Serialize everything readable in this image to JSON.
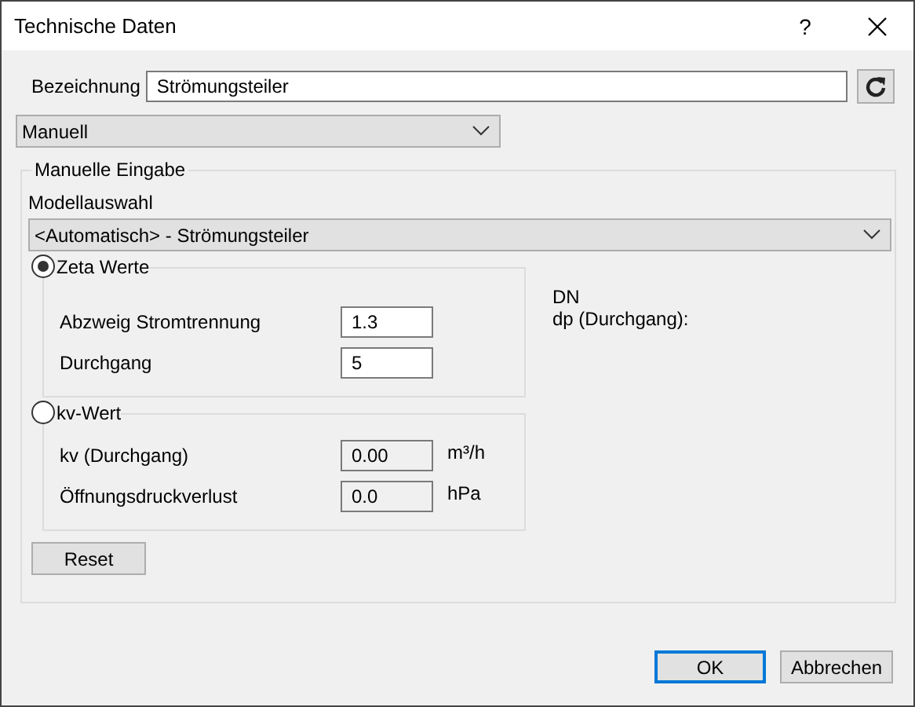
{
  "window": {
    "title": "Technische Daten",
    "help": "?"
  },
  "name_field": {
    "label": "Bezeichnung",
    "value": "Strömungsteiler"
  },
  "mode_select": {
    "value": "Manuell"
  },
  "manual_group": {
    "title": "Manuelle Eingabe",
    "model_label": "Modellauswahl",
    "model_select": {
      "value": "<Automatisch> - Strömungsteiler"
    },
    "options": [
      {
        "label": "Zeta Werte",
        "selected": true,
        "fields": [
          {
            "label": "Abzweig Stromtrennung",
            "value": "1.3",
            "disabled": false
          },
          {
            "label": "Durchgang",
            "value": "5",
            "disabled": false
          }
        ]
      },
      {
        "label": "kv-Wert",
        "selected": false,
        "fields": [
          {
            "label": "kv (Durchgang)",
            "value": "0.00",
            "unit": "m³/h",
            "disabled": true
          },
          {
            "label": "Öffnungsdruckverlust",
            "value": "0.0",
            "unit": "hPa",
            "disabled": true
          }
        ]
      }
    ],
    "info": [
      "DN",
      "dp (Durchgang):"
    ],
    "reset_button": "Reset"
  },
  "buttons": [
    {
      "label": "OK",
      "default": true
    },
    {
      "label": "Abbrechen",
      "default": false
    }
  ]
}
